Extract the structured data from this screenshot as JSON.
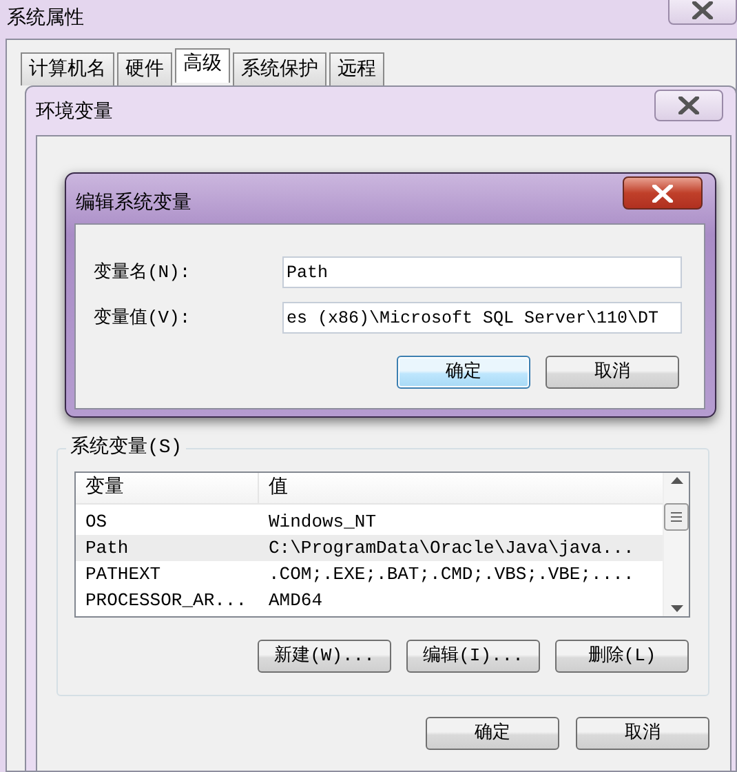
{
  "window": {
    "title": "系统属性",
    "tabs": [
      {
        "label": "计算机名",
        "selected": false
      },
      {
        "label": "硬件",
        "selected": false
      },
      {
        "label": "高级",
        "selected": true
      },
      {
        "label": "系统保护",
        "selected": false
      },
      {
        "label": "远程",
        "selected": false
      }
    ]
  },
  "env_window": {
    "title": "环境变量"
  },
  "edit_dialog": {
    "title": "编辑系统变量",
    "fields": [
      {
        "label": "变量名(N):",
        "value": "Path"
      },
      {
        "label": "变量值(V):",
        "value": "es (x86)\\Microsoft SQL Server\\110\\DT"
      }
    ],
    "buttons": [
      {
        "label": "确定",
        "default": true
      },
      {
        "label": "取消",
        "default": false
      }
    ]
  },
  "system_variables": {
    "title": "系统变量(S)",
    "columns": [
      "变量",
      "值"
    ],
    "rows": [
      {
        "cells": [
          "OS",
          "Windows_NT"
        ],
        "selected": false
      },
      {
        "cells": [
          "Path",
          "C:\\ProgramData\\Oracle\\Java\\java..."
        ],
        "selected": true
      },
      {
        "cells": [
          "PATHEXT",
          ".COM;.EXE;.BAT;.CMD;.VBS;.VBE;...."
        ],
        "selected": false
      },
      {
        "cells": [
          "PROCESSOR_AR...",
          "AMD64"
        ],
        "selected": false
      }
    ],
    "buttons": [
      "新建(W)...",
      "编辑(I)...",
      "删除(L)"
    ]
  },
  "buttons": [
    "确定",
    "取消"
  ]
}
